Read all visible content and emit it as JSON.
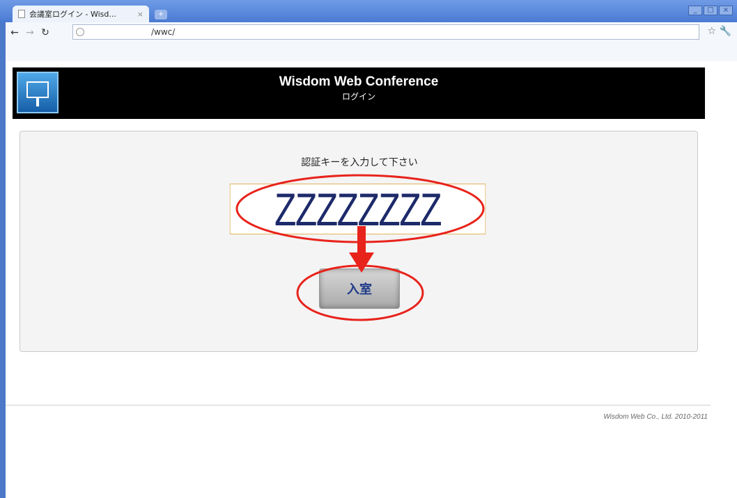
{
  "browser": {
    "tab_title": "会議室ログイン - Wisd...",
    "tab_close": "×",
    "new_tab": "+",
    "url": "/wwc/",
    "window_buttons": [
      "_",
      "□",
      "×"
    ]
  },
  "header": {
    "title": "Wisdom Web Conference",
    "subtitle": "ログイン"
  },
  "login": {
    "prompt": "認証キーを入力して下さい",
    "key_value": "ZZZZZZZZ",
    "enter_label": "入室"
  },
  "annotation": {
    "color": "#e8231b"
  },
  "footer": {
    "copyright": "Wisdom Web Co., Ltd. 2010-2011"
  }
}
